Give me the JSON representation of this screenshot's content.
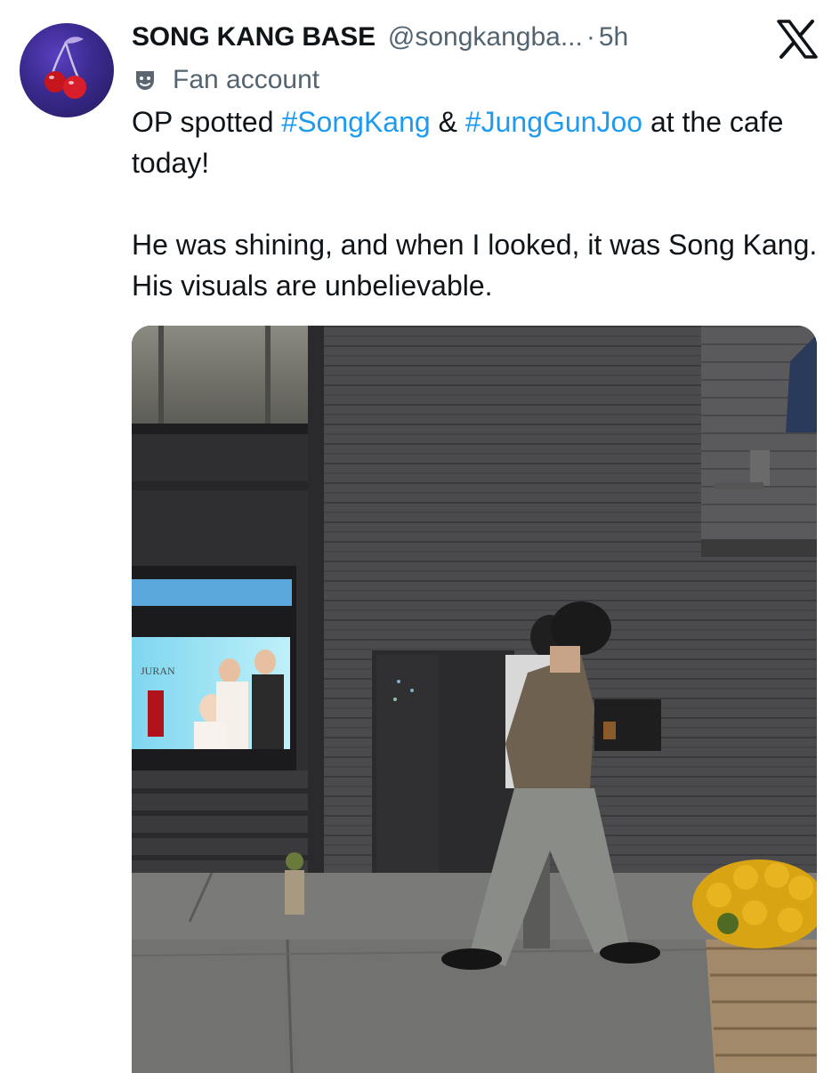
{
  "author": {
    "display_name": "SONG KANG BASE",
    "handle": "@songkangba...",
    "separator": "·",
    "time": "5h",
    "label": "Fan account"
  },
  "icons": {
    "avatar": "cherry-avatar-icon",
    "label": "theater-mask-icon",
    "brand": "x-logo-icon"
  },
  "tweet": {
    "line1_pre": "OP spotted ",
    "hashtag1": "#SongKang",
    "line1_mid": " & ",
    "hashtag2": "#JungGunJoo",
    "line1_post": " at the cafe today!",
    "paragraph2": "He was shining, and when I looked, it was Song Kang. His visuals are unbelievable."
  },
  "media": {
    "billboard_brand": "JURAN"
  },
  "colors": {
    "hashtag": "#1d9bf0",
    "secondary_text": "#536471",
    "primary_text": "#0f1419",
    "avatar_bg": "#3a2a8e"
  }
}
